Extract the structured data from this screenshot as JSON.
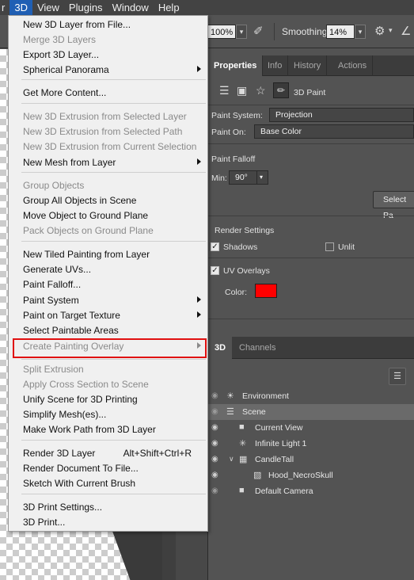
{
  "menubar": {
    "items": [
      {
        "label": "r",
        "active": false
      },
      {
        "label": "3D",
        "active": true
      },
      {
        "label": "View",
        "active": false
      },
      {
        "label": "Plugins",
        "active": false
      },
      {
        "label": "Window",
        "active": false
      },
      {
        "label": "Help",
        "active": false
      }
    ]
  },
  "options_bar": {
    "zoom_value": "100%",
    "smoothing_label": "Smoothing:",
    "smoothing_value": "14%"
  },
  "menu": {
    "items": [
      {
        "label": "New 3D Layer from File...",
        "disabled": false,
        "submenu": false,
        "shortcut": ""
      },
      {
        "label": "Merge 3D Layers",
        "disabled": true,
        "submenu": false,
        "shortcut": ""
      },
      {
        "label": "Export 3D Layer...",
        "disabled": false,
        "submenu": false,
        "shortcut": ""
      },
      {
        "label": "Spherical Panorama",
        "disabled": false,
        "submenu": true,
        "shortcut": ""
      },
      {
        "label": "Get More Content...",
        "disabled": false,
        "submenu": false,
        "shortcut": ""
      },
      {
        "label": "New 3D Extrusion from Selected Layer",
        "disabled": true,
        "submenu": false,
        "shortcut": ""
      },
      {
        "label": "New 3D Extrusion from Selected Path",
        "disabled": true,
        "submenu": false,
        "shortcut": ""
      },
      {
        "label": "New 3D Extrusion from Current Selection",
        "disabled": true,
        "submenu": false,
        "shortcut": ""
      },
      {
        "label": "New Mesh from Layer",
        "disabled": false,
        "submenu": true,
        "shortcut": ""
      },
      {
        "label": "Group Objects",
        "disabled": true,
        "submenu": false,
        "shortcut": ""
      },
      {
        "label": "Group All Objects in Scene",
        "disabled": false,
        "submenu": false,
        "shortcut": ""
      },
      {
        "label": "Move Object to Ground Plane",
        "disabled": false,
        "submenu": false,
        "shortcut": ""
      },
      {
        "label": "Pack Objects on Ground Plane",
        "disabled": true,
        "submenu": false,
        "shortcut": ""
      },
      {
        "label": "New Tiled Painting from Layer",
        "disabled": false,
        "submenu": false,
        "shortcut": ""
      },
      {
        "label": "Generate UVs...",
        "disabled": false,
        "submenu": false,
        "shortcut": ""
      },
      {
        "label": "Paint Falloff...",
        "disabled": false,
        "submenu": false,
        "shortcut": ""
      },
      {
        "label": "Paint System",
        "disabled": false,
        "submenu": true,
        "shortcut": ""
      },
      {
        "label": "Paint on Target Texture",
        "disabled": false,
        "submenu": true,
        "shortcut": ""
      },
      {
        "label": "Select Paintable Areas",
        "disabled": false,
        "submenu": false,
        "shortcut": ""
      },
      {
        "label": "Create Painting Overlay",
        "disabled": true,
        "submenu": true,
        "shortcut": ""
      },
      {
        "label": "Split Extrusion",
        "disabled": true,
        "submenu": false,
        "shortcut": ""
      },
      {
        "label": "Apply Cross Section to Scene",
        "disabled": true,
        "submenu": false,
        "shortcut": ""
      },
      {
        "label": "Unify Scene for 3D Printing",
        "disabled": false,
        "submenu": false,
        "shortcut": ""
      },
      {
        "label": "Simplify Mesh(es)...",
        "disabled": false,
        "submenu": false,
        "shortcut": ""
      },
      {
        "label": "Make Work Path from 3D Layer",
        "disabled": false,
        "submenu": false,
        "shortcut": ""
      },
      {
        "label": "Render 3D Layer",
        "disabled": false,
        "submenu": false,
        "shortcut": "Alt+Shift+Ctrl+R"
      },
      {
        "label": "Render Document To File...",
        "disabled": false,
        "submenu": false,
        "shortcut": ""
      },
      {
        "label": "Sketch With Current Brush",
        "disabled": false,
        "submenu": false,
        "shortcut": ""
      },
      {
        "label": "3D Print Settings...",
        "disabled": false,
        "submenu": false,
        "shortcut": ""
      },
      {
        "label": "3D Print...",
        "disabled": false,
        "submenu": false,
        "shortcut": ""
      }
    ]
  },
  "properties": {
    "tabs": [
      {
        "label": "Properties",
        "active": true
      },
      {
        "label": "Info",
        "active": false
      },
      {
        "label": "History",
        "active": false
      },
      {
        "label": "Actions",
        "active": false
      }
    ],
    "mode_label": "3D Paint",
    "paint_system_label": "Paint System:",
    "paint_system_value": "Projection",
    "paint_on_label": "Paint On:",
    "paint_on_value": "Base Color",
    "paint_falloff_label": "Paint Falloff",
    "min_label": "Min:",
    "min_value": "90°",
    "select_button": "Select Pa",
    "render_settings_label": "Render Settings",
    "shadows_label": "Shadows",
    "shadows_checked": true,
    "unlit_label": "Unlit",
    "unlit_checked": false,
    "uv_overlays_label": "UV Overlays",
    "uv_overlays_checked": true,
    "color_label": "Color:",
    "overlay_color": "#ff0000"
  },
  "threed_panel": {
    "tabs": [
      {
        "label": "3D",
        "active": true
      },
      {
        "label": "Channels",
        "active": false
      }
    ],
    "tree": [
      {
        "label": "Environment",
        "icon": "environment-icon",
        "selected": false
      },
      {
        "label": "Scene",
        "icon": "scene-icon",
        "selected": true
      },
      {
        "label": "Current View",
        "icon": "camera-icon",
        "selected": false
      },
      {
        "label": "Infinite Light 1",
        "icon": "light-icon",
        "selected": false
      },
      {
        "label": "CandleTall",
        "icon": "mesh-icon",
        "selected": false
      },
      {
        "label": "Hood_NecroSkull",
        "icon": "material-icon",
        "selected": false
      },
      {
        "label": "Default Camera",
        "icon": "camera-icon",
        "selected": false
      }
    ]
  },
  "colors": {
    "highlight_box": "#e01010",
    "menubar_active": "#1f5fb4"
  }
}
